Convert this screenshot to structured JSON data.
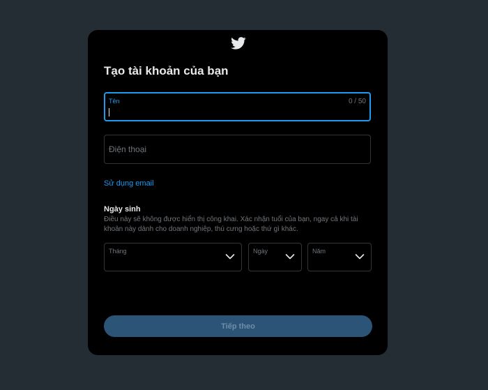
{
  "colors": {
    "background": "#242d34",
    "modal": "#000000",
    "accent": "#1d9bf0",
    "text_primary": "#e7e9ea",
    "text_secondary": "#71767b",
    "border": "#333639",
    "button_disabled": "#2c5477"
  },
  "header": {
    "logo_icon": "twitter-bird-icon"
  },
  "form": {
    "title": "Tạo tài khoản của bạn",
    "name": {
      "label": "Tên",
      "value": "",
      "counter": "0 / 50"
    },
    "phone": {
      "placeholder": "Điện thoại"
    },
    "use_email_link": "Sử dụng email",
    "dob": {
      "heading": "Ngày sinh",
      "description": "Điều này sẽ không được hiển thị công khai.  Xác nhận tuổi của bạn, ngay cả khi tài khoản này dành cho doanh nghiệp, thú cưng hoặc thứ gì khác.",
      "month_label": "Tháng",
      "day_label": "Ngày",
      "year_label": "Năm",
      "chevron_icon": "chevron-down-icon"
    },
    "next_button": "Tiếp theo"
  }
}
